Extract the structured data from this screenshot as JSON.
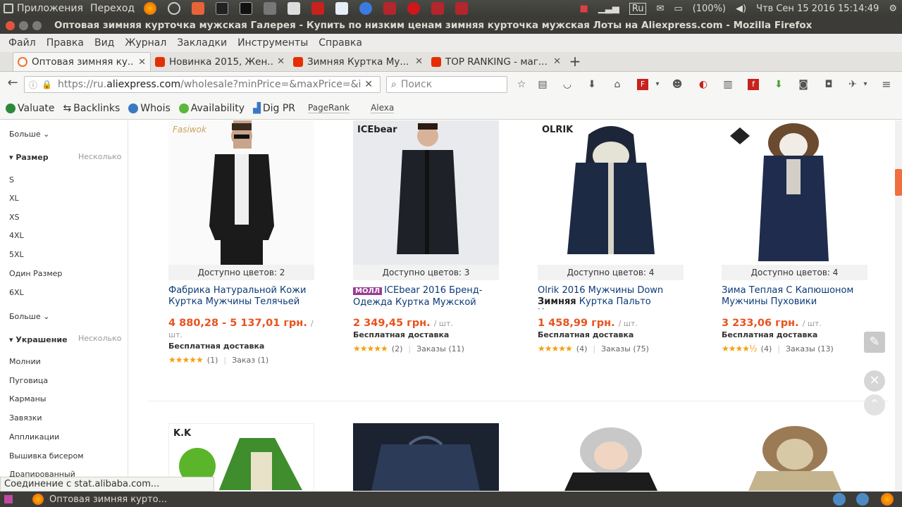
{
  "system_bar": {
    "apps_label": "Приложения",
    "go_label": "Переход",
    "lang": "Ru",
    "battery": "(100%)",
    "datetime": "Чтв Сен 15 2016 15:14:49"
  },
  "window": {
    "title": "Оптовая зимняя курточка мужская Галерея - Купить по низким ценам зимняя курточка мужская Лоты на Aliexpress.com - Mozilla Firefox"
  },
  "menu": [
    "Файл",
    "Правка",
    "Вид",
    "Журнал",
    "Закладки",
    "Инструменты",
    "Справка"
  ],
  "tabs": [
    {
      "label": "Оптовая зимняя ку...",
      "icon_color": "#f0722c"
    },
    {
      "label": "Новинка 2015, Жен...",
      "icon_color": "#e62e04"
    },
    {
      "label": "Зимняя Куртка Му...",
      "icon_color": "#e62e04"
    },
    {
      "label": "TOP RANKING - маг...",
      "icon_color": "#e62e04"
    }
  ],
  "new_tab": "+",
  "nav": {
    "url_prefix": "https://ru.",
    "url_domain": "aliexpress.com",
    "url_rest": "/wholesale?minPrice=&maxPrice=&isB",
    "search_placeholder": "Поиск"
  },
  "seo": {
    "valuate": "Valuate",
    "backlinks": "Backlinks",
    "whois": "Whois",
    "availability": "Availability",
    "digpr": "Dig PR",
    "pagerank": "PageRank",
    "alexa": "Alexa"
  },
  "sidebar": {
    "more1": "Больше",
    "size_header": "Размер",
    "multi1": "Несколько",
    "sizes": [
      "S",
      "XL",
      "XS",
      "4XL",
      "5XL",
      "Один Размер",
      "6XL"
    ],
    "more2": "Больше",
    "deco_header": "Украшение",
    "multi2": "Несколько",
    "decos": [
      "Молнии",
      "Пуговица",
      "Карманы",
      "Завязки",
      "Аппликации",
      "Вышивка бисером",
      "Драпированный"
    ]
  },
  "products": [
    {
      "brand": "Fasiwok",
      "colors": "Доступно цветов: 2",
      "title1": "Фабрика Натуральной Кожи",
      "title2": "Куртка Мужчины Телячьей",
      "price": "4 880,28 - 5 137,01 грн.",
      "unit": "/ шт.",
      "shipping": "Бесплатная доставка",
      "reviews": "(1)",
      "orders": "Заказ (1)"
    },
    {
      "brand": "ICEbear",
      "mall": "МОЛЛ",
      "colors": "Доступно цветов: 3",
      "title1": "ICEbear 2016 Бренд-",
      "title2": "Одежда Куртка Мужской зимний",
      "price": "2 349,45 грн.",
      "unit": "/ шт.",
      "shipping": "Бесплатная доставка",
      "reviews": "(2)",
      "orders": "Заказы (11)"
    },
    {
      "brand": "OLRIK",
      "colors": "Доступно цветов: 4",
      "title1": "Olrik 2016 Мужчины Down",
      "title2_bold": "Зимняя",
      "title2": " Куртка Пальто Короткие",
      "price": "1 458,99 грн.",
      "unit": "/ шт.",
      "shipping": "Бесплатная доставка",
      "reviews": "(4)",
      "orders": "Заказы (75)"
    },
    {
      "colors": "Доступно цветов: 4",
      "title1": "Зима Теплая С Капюшоном",
      "title2": "Мужчины Пуховики",
      "price": "3 233,06 грн.",
      "unit": "/ шт.",
      "shipping": "Бесплатная доставка",
      "reviews": "(4)",
      "orders": "Заказы (13)"
    }
  ],
  "bottom_brand": "K.K",
  "status": "Соединение с stat.alibaba.com...",
  "taskbar_item": "Оптовая зимняя курто..."
}
